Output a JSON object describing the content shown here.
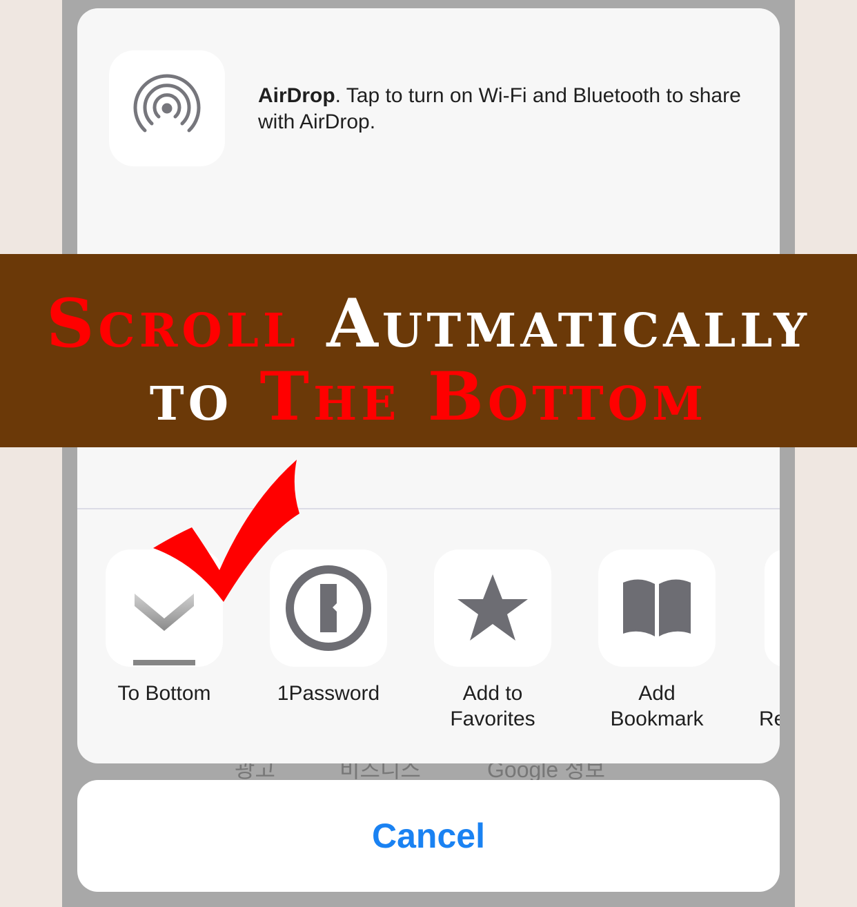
{
  "airdrop": {
    "icon": "airdrop-icon",
    "title": "AirDrop",
    "description": ". Tap to turn on Wi-Fi and Bluetooth to share with AirDrop."
  },
  "banner": {
    "word1": "Scroll",
    "word2": "Autmatically",
    "word3": "to",
    "word4": "The Bottom",
    "colors": {
      "red": "#ff0000",
      "white": "#ffffff",
      "background": "#6b3908"
    }
  },
  "actions": [
    {
      "icon": "to-bottom-icon",
      "label": "To Bottom"
    },
    {
      "icon": "1password-icon",
      "label": "1Password"
    },
    {
      "icon": "star-icon",
      "label": "Add to Favorites"
    },
    {
      "icon": "book-icon",
      "label": "Add Bookmark"
    },
    {
      "icon": "partial-icon",
      "label": "Re"
    }
  ],
  "behind_text": [
    "광고",
    "비즈니스",
    "Google 정보"
  ],
  "cancel": {
    "label": "Cancel",
    "color": "#1a82f2"
  },
  "checkmark": {
    "icon": "red-checkmark-icon",
    "color": "#ff0000"
  }
}
